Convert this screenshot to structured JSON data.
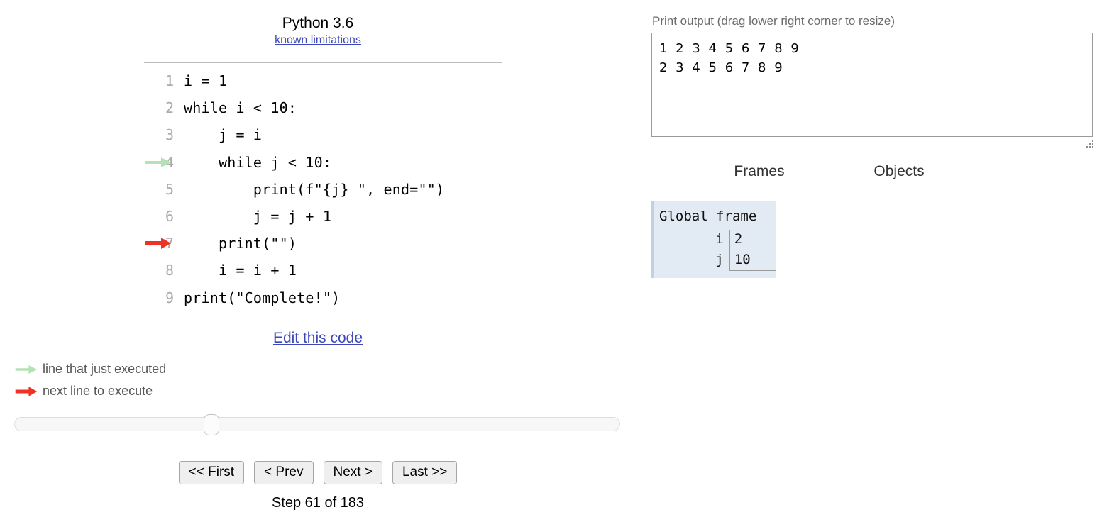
{
  "left": {
    "language": {
      "title": "Python 3.6",
      "limitations_link": "known limitations"
    },
    "code": {
      "lines": [
        {
          "n": "1",
          "text": "i = 1",
          "arrow": "none"
        },
        {
          "n": "2",
          "text": "while i < 10:",
          "arrow": "none"
        },
        {
          "n": "3",
          "text": "    j = i",
          "arrow": "none"
        },
        {
          "n": "4",
          "text": "    while j < 10:",
          "arrow": "green"
        },
        {
          "n": "5",
          "text": "        print(f\"{j} \", end=\"\")",
          "arrow": "none"
        },
        {
          "n": "6",
          "text": "        j = j + 1",
          "arrow": "none"
        },
        {
          "n": "7",
          "text": "    print(\"\")",
          "arrow": "red"
        },
        {
          "n": "8",
          "text": "    i = i + 1",
          "arrow": "none"
        },
        {
          "n": "9",
          "text": "print(\"Complete!\")",
          "arrow": "none"
        }
      ]
    },
    "edit_code_link": "Edit this code",
    "legend": {
      "executed": "line that just executed",
      "next": "next line to execute"
    },
    "slider": {
      "position_percent": 32
    },
    "nav": {
      "first": "<< First",
      "prev": "< Prev",
      "next": "Next >",
      "last": "Last >>"
    },
    "step_status": "Step 61 of 183"
  },
  "right": {
    "print_output": {
      "label": "Print output (drag lower right corner to resize)",
      "text": "1 2 3 4 5 6 7 8 9\n2 3 4 5 6 7 8 9"
    },
    "headings": {
      "frames": "Frames",
      "objects": "Objects"
    },
    "global_frame": {
      "title": "Global frame",
      "variables": [
        {
          "name": "i",
          "value": "2"
        },
        {
          "name": "j",
          "value": "10"
        }
      ]
    }
  },
  "colors": {
    "green_arrow": "#b5e2b5",
    "red_arrow": "#ee3326",
    "link": "#3d48b8",
    "frame_bg": "#e2eaf4",
    "frame_border": "#c3d0e0",
    "lineno": "#aaaaaa",
    "legend_text": "#555555"
  }
}
